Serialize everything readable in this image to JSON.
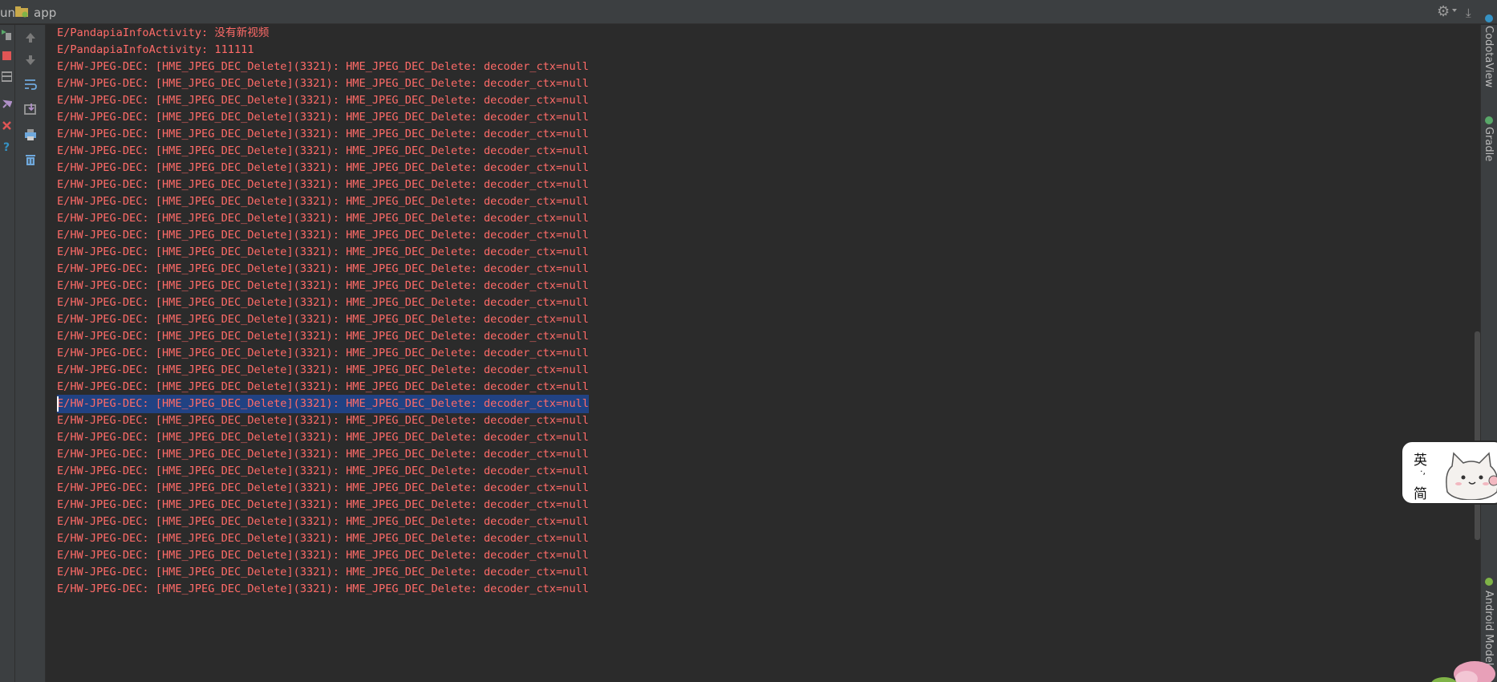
{
  "topbar": {
    "run_label": "un",
    "app_label": "app",
    "app_icon": "android-folder-icon",
    "settings_icon": "gear-icon",
    "hide_icon": "download-icon"
  },
  "left_strip_icons": [
    "rerun-icon",
    "stop-icon",
    "layout-icon",
    "pin-icon",
    "close-icon",
    "help-icon"
  ],
  "console_toolbar_icons": [
    "up-arrow-icon",
    "down-arrow-icon",
    "soft-wrap-icon",
    "scroll-to-end-icon",
    "print-icon",
    "trash-icon"
  ],
  "console": {
    "lines": [
      "E/PandapiaInfoActivity: 没有新视频",
      "E/PandapiaInfoActivity: 111111",
      "E/HW-JPEG-DEC: [HME_JPEG_DEC_Delete](3321): HME_JPEG_DEC_Delete: decoder_ctx=null",
      "E/HW-JPEG-DEC: [HME_JPEG_DEC_Delete](3321): HME_JPEG_DEC_Delete: decoder_ctx=null",
      "E/HW-JPEG-DEC: [HME_JPEG_DEC_Delete](3321): HME_JPEG_DEC_Delete: decoder_ctx=null",
      "E/HW-JPEG-DEC: [HME_JPEG_DEC_Delete](3321): HME_JPEG_DEC_Delete: decoder_ctx=null",
      "E/HW-JPEG-DEC: [HME_JPEG_DEC_Delete](3321): HME_JPEG_DEC_Delete: decoder_ctx=null",
      "E/HW-JPEG-DEC: [HME_JPEG_DEC_Delete](3321): HME_JPEG_DEC_Delete: decoder_ctx=null",
      "E/HW-JPEG-DEC: [HME_JPEG_DEC_Delete](3321): HME_JPEG_DEC_Delete: decoder_ctx=null",
      "E/HW-JPEG-DEC: [HME_JPEG_DEC_Delete](3321): HME_JPEG_DEC_Delete: decoder_ctx=null",
      "E/HW-JPEG-DEC: [HME_JPEG_DEC_Delete](3321): HME_JPEG_DEC_Delete: decoder_ctx=null",
      "E/HW-JPEG-DEC: [HME_JPEG_DEC_Delete](3321): HME_JPEG_DEC_Delete: decoder_ctx=null",
      "E/HW-JPEG-DEC: [HME_JPEG_DEC_Delete](3321): HME_JPEG_DEC_Delete: decoder_ctx=null",
      "E/HW-JPEG-DEC: [HME_JPEG_DEC_Delete](3321): HME_JPEG_DEC_Delete: decoder_ctx=null",
      "E/HW-JPEG-DEC: [HME_JPEG_DEC_Delete](3321): HME_JPEG_DEC_Delete: decoder_ctx=null",
      "E/HW-JPEG-DEC: [HME_JPEG_DEC_Delete](3321): HME_JPEG_DEC_Delete: decoder_ctx=null",
      "E/HW-JPEG-DEC: [HME_JPEG_DEC_Delete](3321): HME_JPEG_DEC_Delete: decoder_ctx=null",
      "E/HW-JPEG-DEC: [HME_JPEG_DEC_Delete](3321): HME_JPEG_DEC_Delete: decoder_ctx=null",
      "E/HW-JPEG-DEC: [HME_JPEG_DEC_Delete](3321): HME_JPEG_DEC_Delete: decoder_ctx=null",
      "E/HW-JPEG-DEC: [HME_JPEG_DEC_Delete](3321): HME_JPEG_DEC_Delete: decoder_ctx=null",
      "E/HW-JPEG-DEC: [HME_JPEG_DEC_Delete](3321): HME_JPEG_DEC_Delete: decoder_ctx=null",
      "E/HW-JPEG-DEC: [HME_JPEG_DEC_Delete](3321): HME_JPEG_DEC_Delete: decoder_ctx=null",
      "E/HW-JPEG-DEC: [HME_JPEG_DEC_Delete](3321): HME_JPEG_DEC_Delete: decoder_ctx=null",
      "E/HW-JPEG-DEC: [HME_JPEG_DEC_Delete](3321): HME_JPEG_DEC_Delete: decoder_ctx=null",
      "E/HW-JPEG-DEC: [HME_JPEG_DEC_Delete](3321): HME_JPEG_DEC_Delete: decoder_ctx=null",
      "E/HW-JPEG-DEC: [HME_JPEG_DEC_Delete](3321): HME_JPEG_DEC_Delete: decoder_ctx=null",
      "E/HW-JPEG-DEC: [HME_JPEG_DEC_Delete](3321): HME_JPEG_DEC_Delete: decoder_ctx=null",
      "E/HW-JPEG-DEC: [HME_JPEG_DEC_Delete](3321): HME_JPEG_DEC_Delete: decoder_ctx=null",
      "E/HW-JPEG-DEC: [HME_JPEG_DEC_Delete](3321): HME_JPEG_DEC_Delete: decoder_ctx=null",
      "E/HW-JPEG-DEC: [HME_JPEG_DEC_Delete](3321): HME_JPEG_DEC_Delete: decoder_ctx=null",
      "E/HW-JPEG-DEC: [HME_JPEG_DEC_Delete](3321): HME_JPEG_DEC_Delete: decoder_ctx=null",
      "E/HW-JPEG-DEC: [HME_JPEG_DEC_Delete](3321): HME_JPEG_DEC_Delete: decoder_ctx=null",
      "E/HW-JPEG-DEC: [HME_JPEG_DEC_Delete](3321): HME_JPEG_DEC_Delete: decoder_ctx=null",
      "E/HW-JPEG-DEC: [HME_JPEG_DEC_Delete](3321): HME_JPEG_DEC_Delete: decoder_ctx=null"
    ],
    "selected_line_index": 22,
    "error_color": "#ff6b68",
    "selection_color": "#214283"
  },
  "right_strip": {
    "tabs": [
      "CodotaView",
      "Gradle",
      "Android Model"
    ]
  },
  "ime_widget": {
    "char_top": "英",
    "char_bottom": "简",
    "separator": "·,",
    "mascot_icon": "cat-mascot-icon"
  },
  "colors": {
    "background": "#2b2b2b",
    "panel": "#3c3f41",
    "text": "#bbbbbb"
  }
}
